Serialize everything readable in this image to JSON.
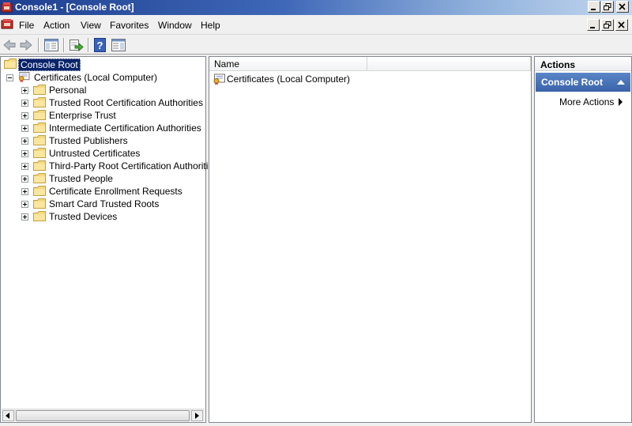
{
  "window": {
    "title": "Console1 - [Console Root]",
    "titlebar_colors": [
      "#1f3f8f",
      "#c4d7ee"
    ]
  },
  "menu": {
    "items": [
      "File",
      "Action",
      "View",
      "Favorites",
      "Window",
      "Help"
    ]
  },
  "toolbar": {
    "buttons": [
      "back-icon",
      "forward-icon",
      "show-hide-console-tree-icon",
      "export-list-icon",
      "help-icon",
      "show-hide-action-pane-icon"
    ]
  },
  "tree": {
    "root": "Console Root",
    "snapin": "Certificates (Local Computer)",
    "stores": [
      "Personal",
      "Trusted Root Certification Authorities",
      "Enterprise Trust",
      "Intermediate Certification Authorities",
      "Trusted Publishers",
      "Untrusted Certificates",
      "Third-Party Root Certification Authorities",
      "Trusted People",
      "Certificate Enrollment Requests",
      "Smart Card Trusted Roots",
      "Trusted Devices"
    ]
  },
  "list": {
    "columns": [
      "Name",
      ""
    ],
    "rows": [
      "Certificates (Local Computer)"
    ]
  },
  "actions": {
    "header": "Actions",
    "section_title": "Console Root",
    "items": [
      "More Actions"
    ],
    "section_color": "#4a76b8"
  }
}
